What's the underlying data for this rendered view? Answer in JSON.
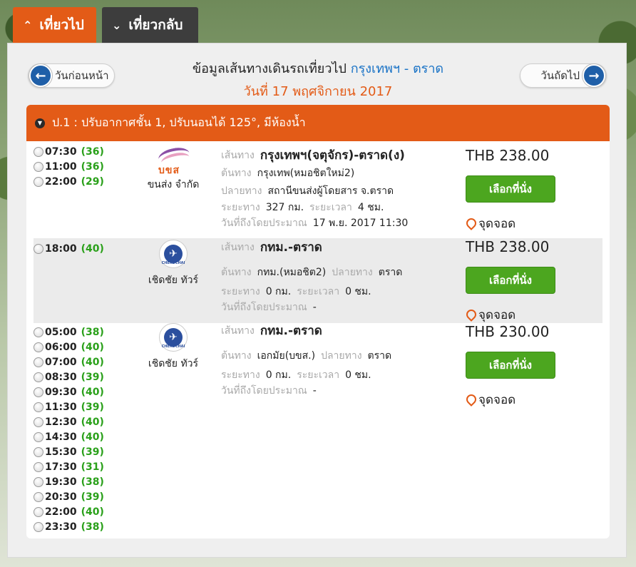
{
  "tabs": {
    "outbound": "เที่ยวไป",
    "return": "เที่ยวกลับ"
  },
  "nav": {
    "prev_label": "วันก่อนหน้า",
    "next_label": "วันถัดไป"
  },
  "header": {
    "title_prefix": "ข้อมูลเส้นทางเดินรถเที่ยวไป",
    "route": "กรุงเทพฯ - ตราด",
    "date": "วันที่ 17 พฤศจิกายน 2017"
  },
  "bus_class": "ป.1 : ปรับอากาศชั้น 1, ปรับนอนได้ 125°, มีห้องน้ำ",
  "labels": {
    "route": "เส้นทาง",
    "origin": "ต้นทาง",
    "destination": "ปลายทาง",
    "distance": "ระยะทาง",
    "duration": "ระยะเวลา",
    "arrival": "วันที่ถึงโดยประมาณ",
    "select": "เลือกที่นั่ง",
    "stop": "จุดจอด"
  },
  "trips": [
    {
      "company": "ขนส่ง จำกัด",
      "logo": "bks-logo",
      "times": [
        {
          "time": "07:30",
          "seats": "(36)"
        },
        {
          "time": "11:00",
          "seats": "(36)"
        },
        {
          "time": "22:00",
          "seats": "(29)"
        }
      ],
      "route": "กรุงเทพฯ(จตุจักร)-ตราด(ง)",
      "origin": "กรุงเทพ(หมอชิตใหม่2)",
      "destination": "สถานีขนส่งผู้โดยสาร จ.ตราด",
      "distance": "327 กม.",
      "duration": "4 ชม.",
      "arrival": "17 พ.ย. 2017 11:30",
      "price": "THB 238.00"
    },
    {
      "company": "เชิดชัย ทัวร์",
      "logo": "cherdchai-logo",
      "times": [
        {
          "time": "18:00",
          "seats": "(40)"
        }
      ],
      "route": "กทม.-ตราด",
      "origin": "กทม.(หมอชิต2)",
      "destination": "ตราด",
      "distance": "0 กม.",
      "duration": "0 ชม.",
      "arrival": "-",
      "price": "THB 238.00"
    },
    {
      "company": "เชิดชัย ทัวร์",
      "logo": "cherdchai-logo",
      "times": [
        {
          "time": "05:00",
          "seats": "(38)"
        },
        {
          "time": "06:00",
          "seats": "(40)"
        },
        {
          "time": "07:00",
          "seats": "(40)"
        },
        {
          "time": "08:30",
          "seats": "(39)"
        },
        {
          "time": "09:30",
          "seats": "(40)"
        },
        {
          "time": "11:30",
          "seats": "(39)"
        },
        {
          "time": "12:30",
          "seats": "(40)"
        },
        {
          "time": "14:30",
          "seats": "(40)"
        },
        {
          "time": "15:30",
          "seats": "(39)"
        },
        {
          "time": "17:30",
          "seats": "(31)"
        },
        {
          "time": "19:30",
          "seats": "(38)"
        },
        {
          "time": "20:30",
          "seats": "(39)"
        },
        {
          "time": "22:00",
          "seats": "(40)"
        },
        {
          "time": "23:30",
          "seats": "(38)"
        }
      ],
      "route": "กทม.-ตราด",
      "origin": "เอกมัย(บขส.)",
      "destination": "ตราด",
      "distance": "0 กม.",
      "duration": "0 ชม.",
      "arrival": "-",
      "price": "THB 230.00"
    }
  ],
  "colors": {
    "accent": "#e35b17",
    "link": "#1a73c6",
    "button": "#4ca61f",
    "seats": "#2aa01a"
  }
}
